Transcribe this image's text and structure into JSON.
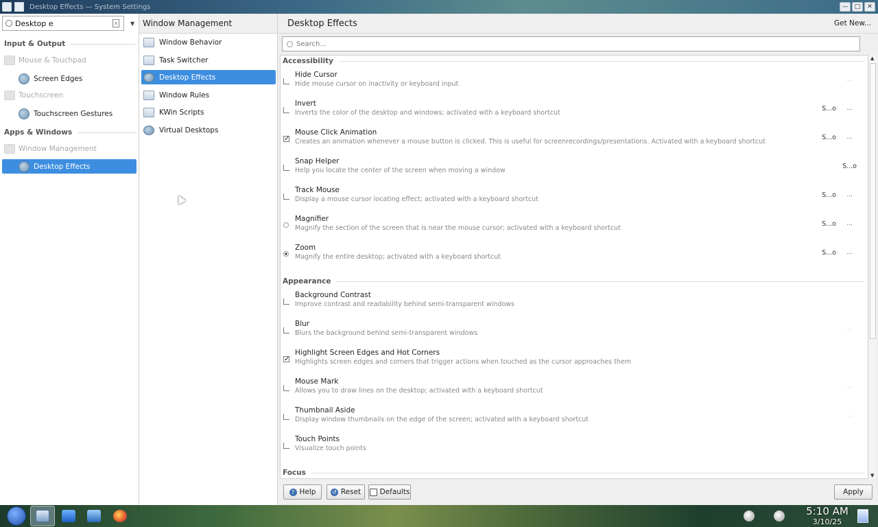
{
  "window": {
    "title": "Desktop Effects  — System Settings"
  },
  "left": {
    "search_value": "Desktop e",
    "categories": [
      {
        "label": "Input & Output"
      },
      {
        "label": "Apps & Windows"
      }
    ],
    "parents": [
      {
        "label": "Mouse & Touchpad"
      },
      {
        "label": "Touchscreen"
      },
      {
        "label": "Window Management"
      }
    ],
    "children": [
      {
        "label": "Screen Edges"
      },
      {
        "label": "Touchscreen Gestures"
      },
      {
        "label": "Desktop Effects"
      }
    ]
  },
  "middle": {
    "header": "Window Management",
    "items": [
      {
        "label": "Window Behavior"
      },
      {
        "label": "Task Switcher"
      },
      {
        "label": "Desktop Effects"
      },
      {
        "label": "Window Rules"
      },
      {
        "label": "KWin Scripts"
      },
      {
        "label": "Virtual Desktops"
      }
    ]
  },
  "right": {
    "header": "Desktop Effects",
    "get_new": "Get New...",
    "search_placeholder": "Search...",
    "groups": [
      {
        "label": "Accessibility"
      },
      {
        "label": "Appearance"
      },
      {
        "label": "Focus"
      }
    ],
    "effects": [
      {
        "name": "Hide Cursor",
        "desc": "Hide mouse cursor on inactivity or keyboard input",
        "checked": false,
        "shortcut": "",
        "more": "..."
      },
      {
        "name": "Invert",
        "desc": "Inverts the color of the desktop and windows; activated with a keyboard shortcut",
        "checked": false,
        "shortcut": "S...o",
        "more": "..."
      },
      {
        "name": "Mouse Click Animation",
        "desc": "Creates an animation whenever a mouse button is clicked. This is useful for screenrecordings/presentations. Activated with a keyboard shortcut",
        "checked": true,
        "shortcut": "S...o",
        "more": "..."
      },
      {
        "name": "Snap Helper",
        "desc": "Help you locate the center of the screen when moving a window",
        "checked": false,
        "shortcut": "S...o",
        "more": ""
      },
      {
        "name": "Track Mouse",
        "desc": "Display a mouse cursor locating effect; activated with a keyboard shortcut",
        "checked": false,
        "shortcut": "S...o",
        "more": "..."
      },
      {
        "name": "Magnifier",
        "desc": "Magnify the section of the screen that is near the mouse cursor; activated with a keyboard shortcut",
        "checked": false,
        "shortcut": "S...o",
        "more": "..."
      },
      {
        "name": "Zoom",
        "desc": "Magnify the entire desktop; activated with a keyboard shortcut",
        "checked": true,
        "shortcut": "S...o",
        "more": "..."
      },
      {
        "name": "Background Contrast",
        "desc": "Improve contrast and readability behind semi-transparent windows",
        "checked": false,
        "shortcut": "",
        "more": ""
      },
      {
        "name": "Blur",
        "desc": "Blurs the background behind semi-transparent windows",
        "checked": false,
        "shortcut": "",
        "more": "..."
      },
      {
        "name": "Highlight Screen Edges and Hot Corners",
        "desc": "Highlights screen edges and corners that trigger actions when touched as the cursor approaches them",
        "checked": true,
        "shortcut": "",
        "more": ""
      },
      {
        "name": "Mouse Mark",
        "desc": "Allows you to draw lines on the desktop; activated with a keyboard shortcut",
        "checked": false,
        "shortcut": "",
        "more": "..."
      },
      {
        "name": "Thumbnail Aside",
        "desc": "Display window thumbnails on the edge of the screen; activated with a keyboard shortcut",
        "checked": false,
        "shortcut": "",
        "more": "..."
      },
      {
        "name": "Touch Points",
        "desc": "Visualize touch points",
        "checked": false,
        "shortcut": "",
        "more": ""
      }
    ],
    "buttons": {
      "help": "Help",
      "reset": "Reset",
      "defaults": "Defaults",
      "apply": "Apply"
    }
  },
  "taskbar": {
    "time": "5:10 AM",
    "date": "3/10/25"
  },
  "colors": {
    "selection": "#3d8ee0",
    "accent_text": "#ffffff"
  }
}
